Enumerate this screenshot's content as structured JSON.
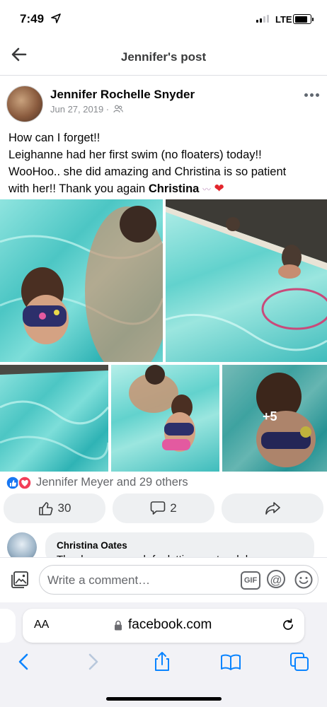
{
  "status_bar": {
    "time": "7:49",
    "network": "LTE"
  },
  "header": {
    "title": "Jennifer's post"
  },
  "post": {
    "author": "Jennifer Rochelle Snyder",
    "date": "Jun 27, 2019 ·",
    "text_lines": [
      "How can I forget!!",
      "Leighanne had her first swim (no floaters) today!!",
      "WooHoo.. she did amazing and Christina is so patient",
      "with her!!  Thank you again "
    ],
    "mention": "Christina",
    "more_photos": "+5",
    "reactions_text": "Jennifer Meyer and 29 others",
    "like_count": "30",
    "comment_count": "2"
  },
  "comment": {
    "author": "Christina Oates",
    "preview": "Thank you so much for letting me teach her"
  },
  "composer": {
    "placeholder": "Write a comment…",
    "gif_label": "GIF",
    "at_label": "@"
  },
  "browser": {
    "aa_label": "AA",
    "url": "facebook.com"
  },
  "colors": {
    "facebook_blue": "#1877f2",
    "love_red": "#f33e58",
    "ios_blue": "#0a84ff"
  }
}
